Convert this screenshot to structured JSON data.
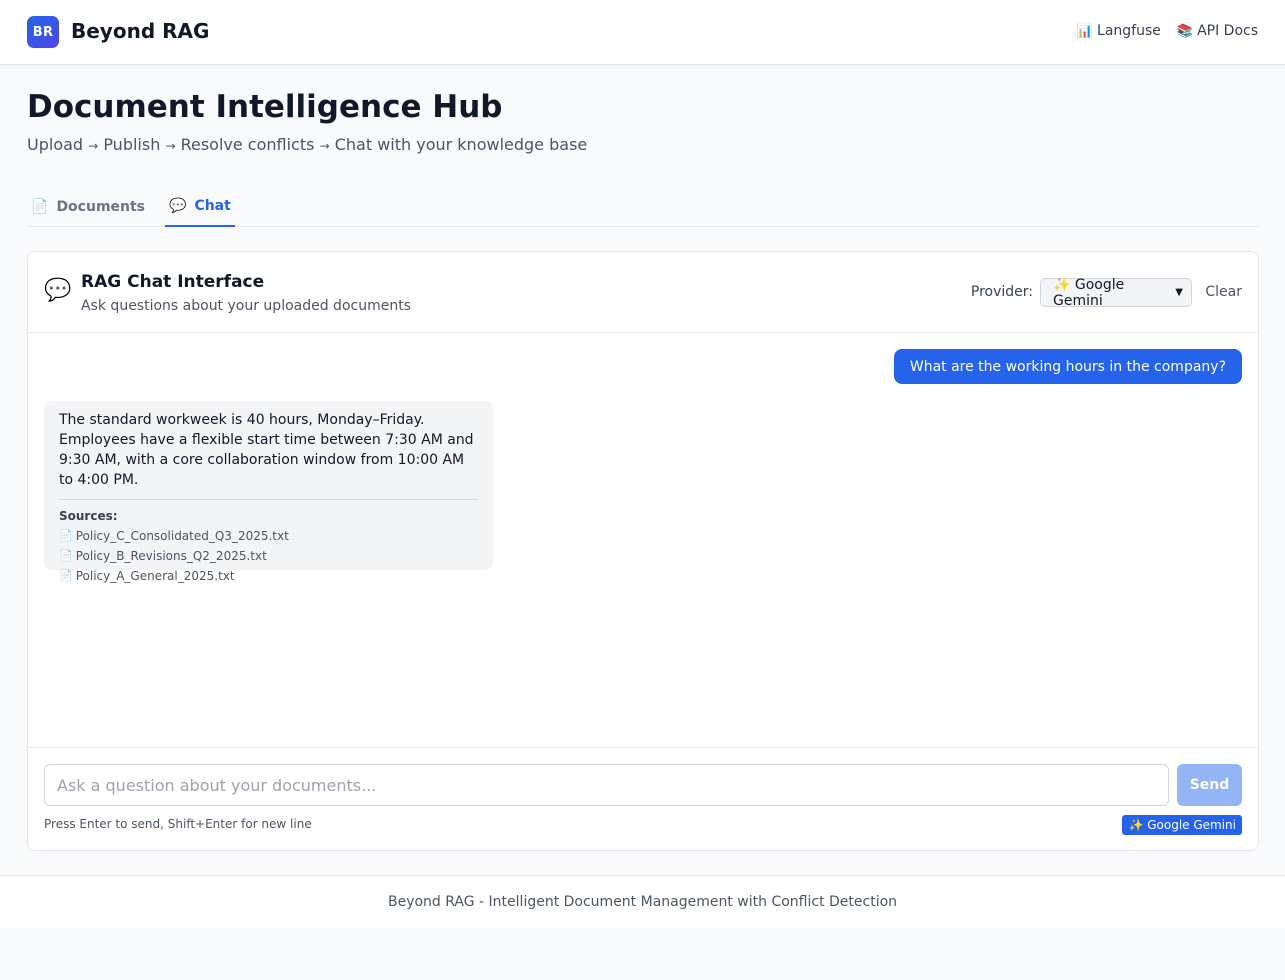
{
  "header": {
    "logo_text": "BR",
    "brand": "Beyond RAG",
    "links": [
      {
        "icon": "📊",
        "label": "Langfuse"
      },
      {
        "icon": "📚",
        "label": "API Docs"
      }
    ]
  },
  "page": {
    "title": "Document Intelligence Hub",
    "steps": [
      "Upload",
      "Publish",
      "Resolve conflicts",
      "Chat with your knowledge base"
    ],
    "arrow": "→"
  },
  "tabs": [
    {
      "icon": "📄",
      "label": "Documents",
      "active": false
    },
    {
      "icon": "💬",
      "label": "Chat",
      "active": true
    }
  ],
  "chat": {
    "icon": "💬",
    "title": "RAG Chat Interface",
    "subtitle": "Ask questions about your uploaded documents",
    "provider_label": "Provider:",
    "provider_selected": "✨ Google Gemini",
    "clear_label": "Clear",
    "messages": {
      "user": "What are the working hours in the company?",
      "assistant": "The standard workweek is 40 hours, Monday–Friday. Employees have a flexible start time between 7:30 AM and 9:30 AM, with a core collaboration window from 10:00 AM to 4:00 PM.",
      "sources_label": "Sources:",
      "sources": [
        "Policy_C_Consolidated_Q3_2025.txt",
        "Policy_B_Revisions_Q2_2025.txt",
        "Policy_A_General_2025.txt"
      ],
      "source_icon": "📄"
    },
    "input": {
      "placeholder": "Ask a question about your documents...",
      "value": "",
      "send_label": "Send",
      "hint": "Press Enter to send, Shift+Enter for new line",
      "provider_badge": "✨ Google Gemini"
    }
  },
  "footer": {
    "text": "Beyond RAG - Intelligent Document Management with Conflict Detection"
  },
  "colors": {
    "accent": "#2563eb",
    "send_disabled": "#93b4f5",
    "background": "#f9fafb"
  }
}
